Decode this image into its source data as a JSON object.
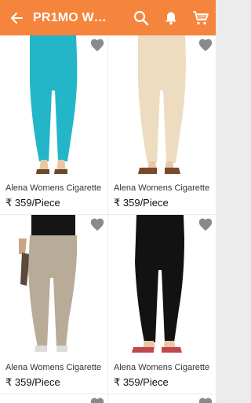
{
  "appbar": {
    "title": "PR1MO Wo...",
    "icons": [
      "back-arrow-icon",
      "search-icon",
      "bell-icon",
      "cart-icon"
    ]
  },
  "colors": {
    "accent": "#f5843c",
    "heart": "#8a8a8a"
  },
  "products": [
    {
      "name": "Alena Womens  Cigarette",
      "price": "₹ 359/Piece",
      "pant_color": "#22b6c8"
    },
    {
      "name": "Alena Womens  Cigarette",
      "price": "₹ 359/Piece",
      "pant_color": "#eddcc0"
    },
    {
      "name": "Alena Womens  Cigarette",
      "price": "₹ 359/Piece",
      "pant_color": "#b8ab97"
    },
    {
      "name": "Alena Womens  Cigarette",
      "price": "₹ 359/Piece",
      "pant_color": "#121212"
    }
  ]
}
